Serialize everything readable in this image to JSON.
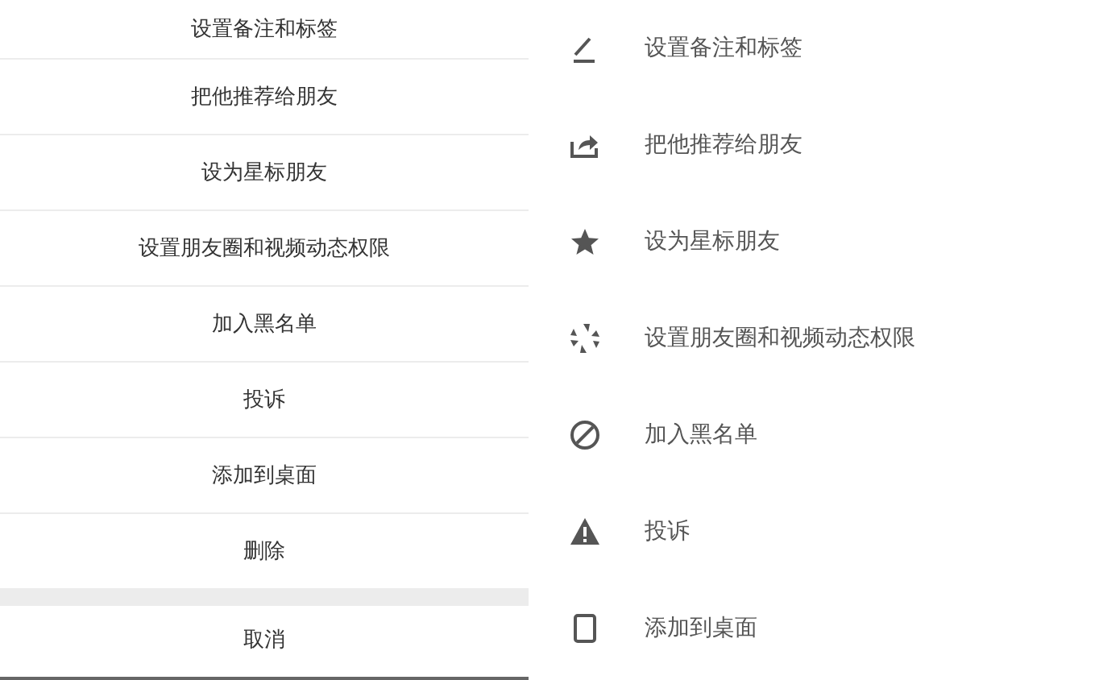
{
  "action_sheet": {
    "items": [
      {
        "label": "设置备注和标签"
      },
      {
        "label": "把他推荐给朋友"
      },
      {
        "label": "设为星标朋友"
      },
      {
        "label": "设置朋友圈和视频动态权限"
      },
      {
        "label": "加入黑名单"
      },
      {
        "label": "投诉"
      },
      {
        "label": "添加到桌面"
      },
      {
        "label": "删除"
      }
    ],
    "cancel": "取消"
  },
  "menu": {
    "items": [
      {
        "label": "设置备注和标签"
      },
      {
        "label": "把他推荐给朋友"
      },
      {
        "label": "设为星标朋友"
      },
      {
        "label": "设置朋友圈和视频动态权限"
      },
      {
        "label": "加入黑名单"
      },
      {
        "label": "投诉"
      },
      {
        "label": "添加到桌面"
      }
    ]
  }
}
